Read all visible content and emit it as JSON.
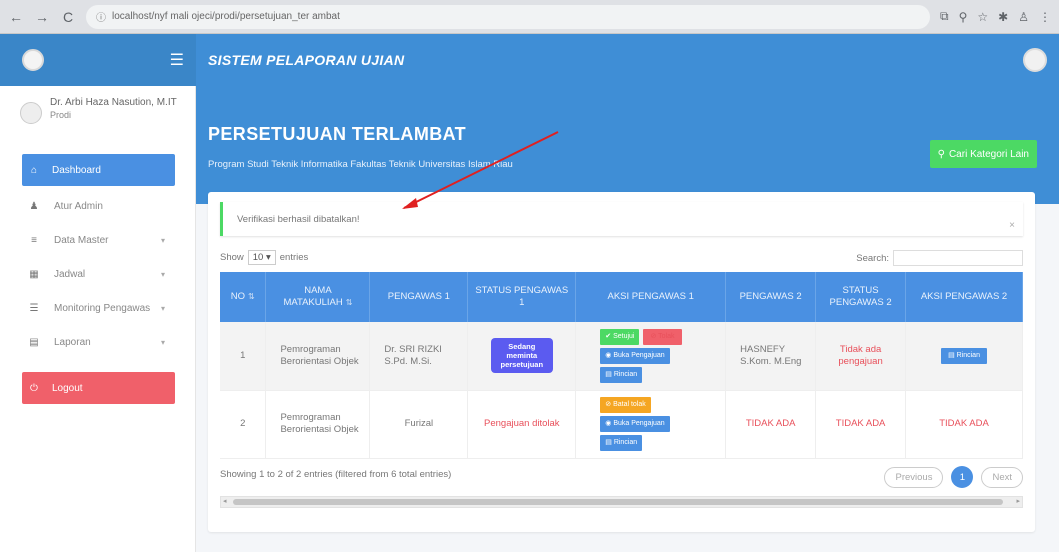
{
  "browser": {
    "back": "←",
    "forward": "→",
    "reload": "C",
    "url": "localhost/nyf mali ojeci/prodi/persetujuan_ter ambat"
  },
  "header": {
    "app_title": "SISTEM PELAPORAN UJIAN",
    "menu_icon": "hamburger-icon"
  },
  "sidebar": {
    "user_name": "Dr. Arbi Haza Nasution, M.IT",
    "user_role": "Prodi",
    "items": [
      {
        "label": "Dashboard",
        "icon": "home-icon",
        "glyph": "⌂",
        "active": true
      },
      {
        "label": "Atur Admin",
        "icon": "user-icon",
        "glyph": "♟"
      },
      {
        "label": "Data Master",
        "icon": "database-icon",
        "glyph": "≡",
        "chevron": true
      },
      {
        "label": "Jadwal",
        "icon": "calendar-icon",
        "glyph": "▦",
        "chevron": true
      },
      {
        "label": "Monitoring Pengawas",
        "icon": "list-icon",
        "glyph": "☰",
        "chevron": true
      },
      {
        "label": "Laporan",
        "icon": "report-icon",
        "glyph": "▤",
        "chevron": true
      }
    ],
    "logout": "Logout"
  },
  "page": {
    "title": "PERSETUJUAN TERLAMBAT",
    "subtitle": "Program Studi Teknik Informatika Fakultas Teknik Universitas Islam Riau",
    "btn_kategori": "Cari Kategori Lain"
  },
  "alert": {
    "text": "Verifikasi berhasil dibatalkan!",
    "close": "×"
  },
  "table_controls": {
    "show_label": "Show",
    "entries_value": "10",
    "entries_label": "entries",
    "search_label": "Search:"
  },
  "table": {
    "columns": [
      "NO",
      "NAMA MATAKULIAH",
      "PENGAWAS 1",
      "STATUS PENGAWAS 1",
      "AKSI PENGAWAS 1",
      "PENGAWAS 2",
      "STATUS PENGAWAS 2",
      "AKSI PENGAWAS 2"
    ],
    "rows": [
      {
        "no": "1",
        "matakuliah": "Pemrograman Berorientasi Objek",
        "pengawas1": "Dr. SRI RIZKI S.Pd. M.Si.",
        "status1": "Sedang meminta persetujuan",
        "aksi1": {
          "setujui": "Setujui",
          "tolak": "Tolak",
          "buka": "Buka Pengajuan",
          "rincian": "Rincian"
        },
        "pengawas2": "HASNEFY S.Kom. M.Eng",
        "status2": "Tidak ada pengajuan",
        "aksi2": "Rincian"
      },
      {
        "no": "2",
        "matakuliah": "Pemrograman Berorientasi Objek",
        "pengawas1": "Furizal",
        "status1": "Pengajuan ditolak",
        "aksi1": {
          "batal": "Batal tolak",
          "buka": "Buka Pengajuan",
          "rincian": "Rincian"
        },
        "pengawas2": "TIDAK ADA",
        "status2": "TIDAK ADA",
        "aksi2": "TIDAK ADA"
      }
    ]
  },
  "footer": {
    "info": "Showing 1 to 2 of 2 entries (filtered from 6 total entries)",
    "previous": "Previous",
    "page": "1",
    "next": "Next"
  }
}
